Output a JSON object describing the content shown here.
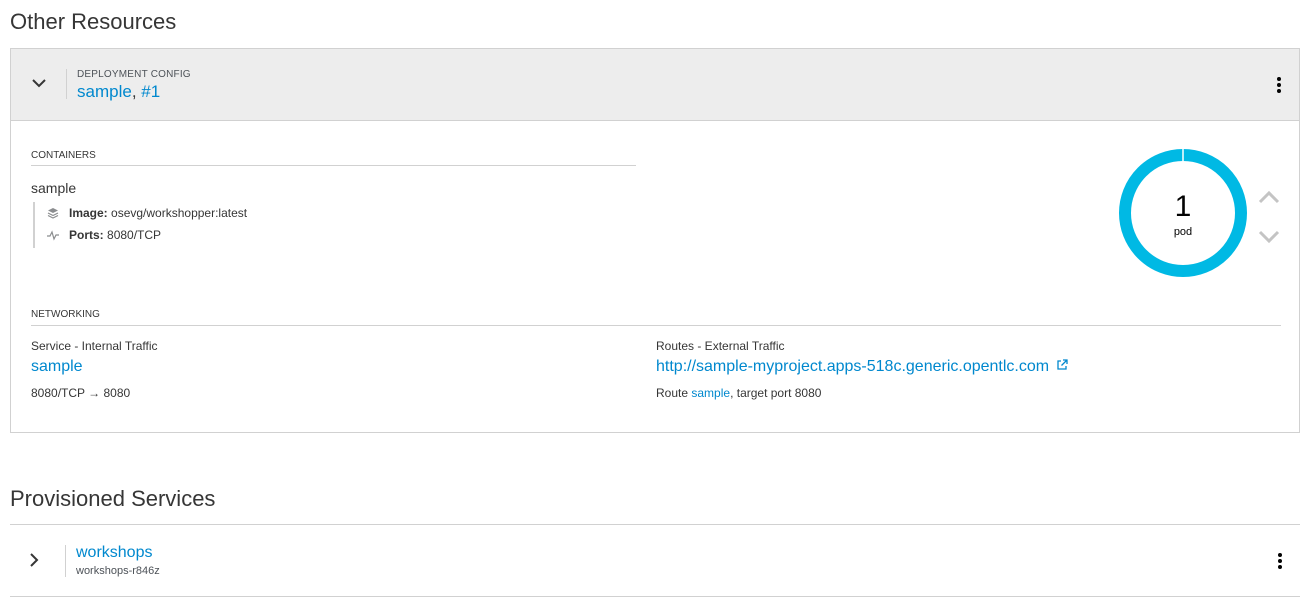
{
  "sections": {
    "other_resources": "Other Resources",
    "provisioned_services": "Provisioned Services"
  },
  "deployment": {
    "kind": "DEPLOYMENT CONFIG",
    "name": "sample",
    "separator": ",",
    "version": "#1",
    "containers_label": "CONTAINERS",
    "container": {
      "name": "sample",
      "image_label": "Image:",
      "image_value": "osevg/workshopper:latest",
      "ports_label": "Ports:",
      "ports_value": "8080/TCP"
    },
    "pods": {
      "count": "1",
      "label": "pod",
      "ring_color": "#00b9e4"
    },
    "networking": {
      "label": "NETWORKING",
      "service_heading": "Service - Internal Traffic",
      "service_name": "sample",
      "service_ports": "8080/TCP → 8080",
      "routes_heading": "Routes - External Traffic",
      "route_url": "http://sample-myproject.apps-518c.generic.opentlc.com",
      "route_prefix": "Route",
      "route_name": "sample",
      "route_suffix": ", target port 8080"
    }
  },
  "provisioned": {
    "name": "workshops",
    "id": "workshops-r846z"
  }
}
